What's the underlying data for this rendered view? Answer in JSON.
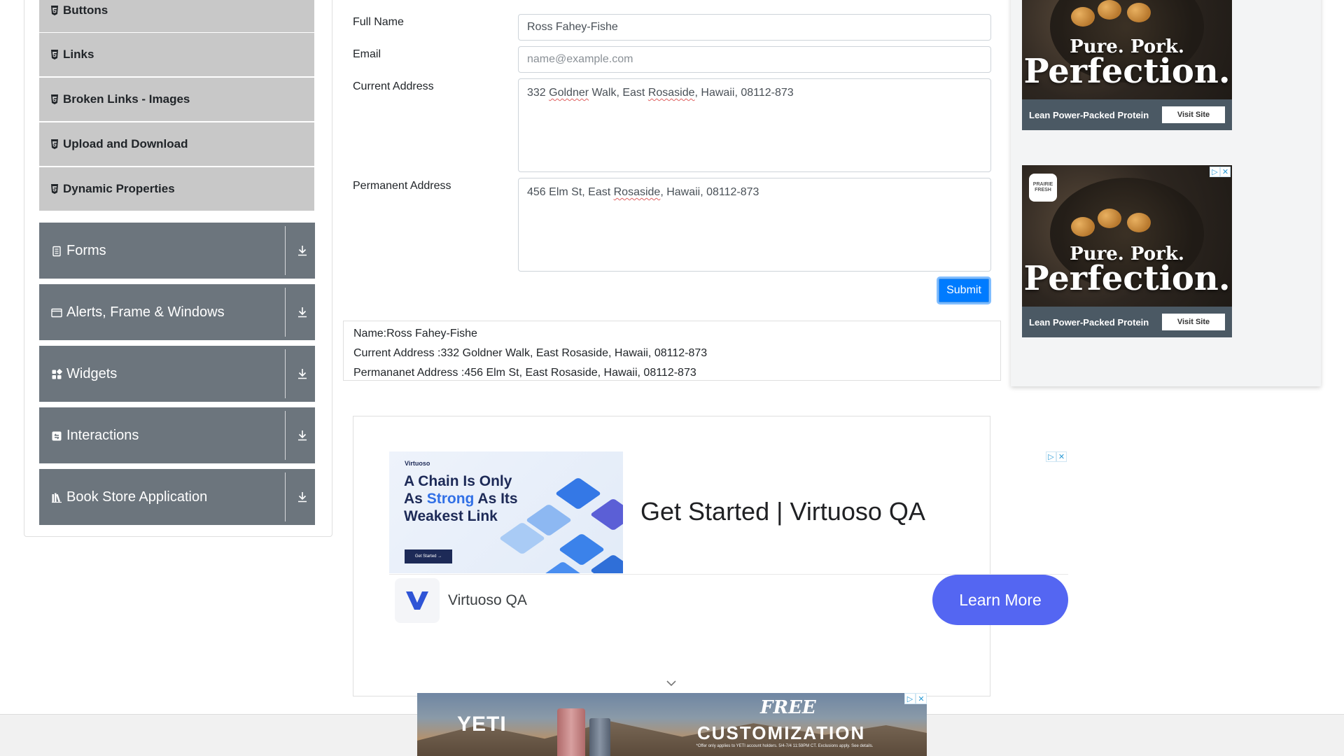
{
  "sidebar": {
    "sub_items": [
      {
        "label": "Buttons"
      },
      {
        "label": "Links"
      },
      {
        "label": "Broken Links - Images"
      },
      {
        "label": "Upload and Download"
      },
      {
        "label": "Dynamic Properties"
      }
    ],
    "groups": [
      {
        "label": "Forms",
        "icon": "document-icon"
      },
      {
        "label": "Alerts, Frame & Windows",
        "icon": "window-icon"
      },
      {
        "label": "Widgets",
        "icon": "widgets-icon"
      },
      {
        "label": "Interactions",
        "icon": "interaction-icon"
      },
      {
        "label": "Book Store Application",
        "icon": "books-icon"
      }
    ]
  },
  "form": {
    "full_name_label": "Full Name",
    "full_name_value": "Ross Fahey-Fishe",
    "email_label": "Email",
    "email_placeholder": "name@example.com",
    "current_address_label": "Current Address",
    "current_address_value": {
      "part1": "332 ",
      "part2": "Goldner",
      "part3": " Walk, East ",
      "part4": "Rosaside",
      "part5": ", Hawaii, 08112-873"
    },
    "permanent_address_label": "Permanent Address",
    "permanent_address_value": {
      "part1": "456 Elm St, East ",
      "part2": "Rosaside",
      "part3": ", Hawaii, 08112-873"
    },
    "submit_label": "Submit"
  },
  "output": {
    "name_line": "Name:Ross Fahey-Fishe",
    "current_line": "Current Address :332 Goldner Walk, East Rosaside, Hawaii, 08112-873",
    "permanent_line": "Permananet Address :456 Elm St, East Rosaside, Hawaii, 08112-873"
  },
  "ads": {
    "pork": {
      "line1": "Pure. Pork.",
      "line2": "Perfection.",
      "tagline": "Lean Power-Packed Protein",
      "cta": "Visit Site",
      "logo_text": "PRAIRIE FRESH"
    },
    "virtuoso": {
      "brand": "Virtuoso",
      "headline_a": "A Chain Is Only",
      "headline_b1": "As ",
      "headline_b2": "Strong",
      "headline_b3": " As Its",
      "headline_c": "Weakest Link",
      "thumb_cta": "Get Started →",
      "title": "Get Started | Virtuoso QA",
      "advertiser": "Virtuoso QA",
      "cta": "Learn More",
      "accent": "#5466f2"
    },
    "yeti": {
      "logo": "YETI",
      "free": "FREE",
      "customization": "CUSTOMIZATION",
      "fine_print": "*Offer only applies to YETI account holders. 5/4-7/4 11:59PM CT. Exclusions apply. See details."
    }
  },
  "colors": {
    "primary": "#007bff",
    "sidebar_group": "#6c757d",
    "sidebar_sub": "#c8c8c8"
  }
}
